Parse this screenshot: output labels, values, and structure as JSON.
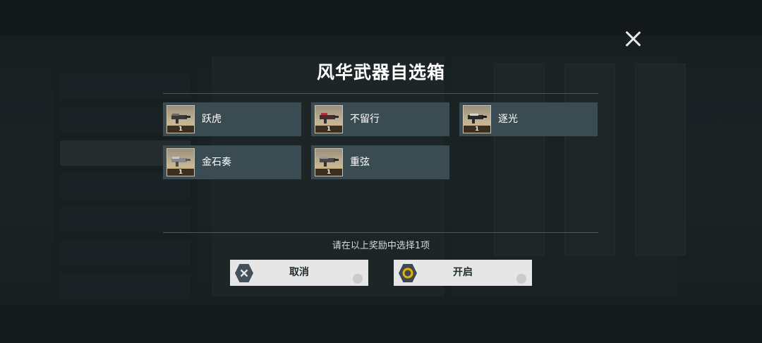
{
  "dialog": {
    "title": "风华武器自选箱",
    "hint": "请在以上奖励中选择1项",
    "items": [
      {
        "name": "跃虎",
        "qty": "1"
      },
      {
        "name": "不留行",
        "qty": "1"
      },
      {
        "name": "逐光",
        "qty": "1"
      },
      {
        "name": "金石奏",
        "qty": "1"
      },
      {
        "name": "重弦",
        "qty": "1"
      }
    ],
    "cancel_label": "取消",
    "confirm_label": "开启"
  },
  "colors": {
    "item_bg": "#3a4b52",
    "button_bg": "#e6e6e6",
    "confirm_ring": "#e3b200"
  }
}
